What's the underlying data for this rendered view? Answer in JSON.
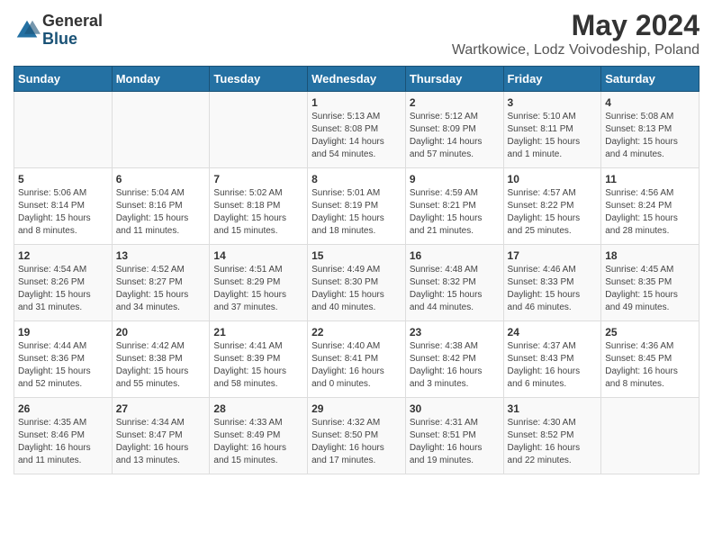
{
  "header": {
    "logo_general": "General",
    "logo_blue": "Blue",
    "month_title": "May 2024",
    "location": "Wartkowice, Lodz Voivodeship, Poland"
  },
  "weekdays": [
    "Sunday",
    "Monday",
    "Tuesday",
    "Wednesday",
    "Thursday",
    "Friday",
    "Saturday"
  ],
  "weeks": [
    [
      {
        "day": "",
        "info": ""
      },
      {
        "day": "",
        "info": ""
      },
      {
        "day": "",
        "info": ""
      },
      {
        "day": "1",
        "info": "Sunrise: 5:13 AM\nSunset: 8:08 PM\nDaylight: 14 hours\nand 54 minutes."
      },
      {
        "day": "2",
        "info": "Sunrise: 5:12 AM\nSunset: 8:09 PM\nDaylight: 14 hours\nand 57 minutes."
      },
      {
        "day": "3",
        "info": "Sunrise: 5:10 AM\nSunset: 8:11 PM\nDaylight: 15 hours\nand 1 minute."
      },
      {
        "day": "4",
        "info": "Sunrise: 5:08 AM\nSunset: 8:13 PM\nDaylight: 15 hours\nand 4 minutes."
      }
    ],
    [
      {
        "day": "5",
        "info": "Sunrise: 5:06 AM\nSunset: 8:14 PM\nDaylight: 15 hours\nand 8 minutes."
      },
      {
        "day": "6",
        "info": "Sunrise: 5:04 AM\nSunset: 8:16 PM\nDaylight: 15 hours\nand 11 minutes."
      },
      {
        "day": "7",
        "info": "Sunrise: 5:02 AM\nSunset: 8:18 PM\nDaylight: 15 hours\nand 15 minutes."
      },
      {
        "day": "8",
        "info": "Sunrise: 5:01 AM\nSunset: 8:19 PM\nDaylight: 15 hours\nand 18 minutes."
      },
      {
        "day": "9",
        "info": "Sunrise: 4:59 AM\nSunset: 8:21 PM\nDaylight: 15 hours\nand 21 minutes."
      },
      {
        "day": "10",
        "info": "Sunrise: 4:57 AM\nSunset: 8:22 PM\nDaylight: 15 hours\nand 25 minutes."
      },
      {
        "day": "11",
        "info": "Sunrise: 4:56 AM\nSunset: 8:24 PM\nDaylight: 15 hours\nand 28 minutes."
      }
    ],
    [
      {
        "day": "12",
        "info": "Sunrise: 4:54 AM\nSunset: 8:26 PM\nDaylight: 15 hours\nand 31 minutes."
      },
      {
        "day": "13",
        "info": "Sunrise: 4:52 AM\nSunset: 8:27 PM\nDaylight: 15 hours\nand 34 minutes."
      },
      {
        "day": "14",
        "info": "Sunrise: 4:51 AM\nSunset: 8:29 PM\nDaylight: 15 hours\nand 37 minutes."
      },
      {
        "day": "15",
        "info": "Sunrise: 4:49 AM\nSunset: 8:30 PM\nDaylight: 15 hours\nand 40 minutes."
      },
      {
        "day": "16",
        "info": "Sunrise: 4:48 AM\nSunset: 8:32 PM\nDaylight: 15 hours\nand 44 minutes."
      },
      {
        "day": "17",
        "info": "Sunrise: 4:46 AM\nSunset: 8:33 PM\nDaylight: 15 hours\nand 46 minutes."
      },
      {
        "day": "18",
        "info": "Sunrise: 4:45 AM\nSunset: 8:35 PM\nDaylight: 15 hours\nand 49 minutes."
      }
    ],
    [
      {
        "day": "19",
        "info": "Sunrise: 4:44 AM\nSunset: 8:36 PM\nDaylight: 15 hours\nand 52 minutes."
      },
      {
        "day": "20",
        "info": "Sunrise: 4:42 AM\nSunset: 8:38 PM\nDaylight: 15 hours\nand 55 minutes."
      },
      {
        "day": "21",
        "info": "Sunrise: 4:41 AM\nSunset: 8:39 PM\nDaylight: 15 hours\nand 58 minutes."
      },
      {
        "day": "22",
        "info": "Sunrise: 4:40 AM\nSunset: 8:41 PM\nDaylight: 16 hours\nand 0 minutes."
      },
      {
        "day": "23",
        "info": "Sunrise: 4:38 AM\nSunset: 8:42 PM\nDaylight: 16 hours\nand 3 minutes."
      },
      {
        "day": "24",
        "info": "Sunrise: 4:37 AM\nSunset: 8:43 PM\nDaylight: 16 hours\nand 6 minutes."
      },
      {
        "day": "25",
        "info": "Sunrise: 4:36 AM\nSunset: 8:45 PM\nDaylight: 16 hours\nand 8 minutes."
      }
    ],
    [
      {
        "day": "26",
        "info": "Sunrise: 4:35 AM\nSunset: 8:46 PM\nDaylight: 16 hours\nand 11 minutes."
      },
      {
        "day": "27",
        "info": "Sunrise: 4:34 AM\nSunset: 8:47 PM\nDaylight: 16 hours\nand 13 minutes."
      },
      {
        "day": "28",
        "info": "Sunrise: 4:33 AM\nSunset: 8:49 PM\nDaylight: 16 hours\nand 15 minutes."
      },
      {
        "day": "29",
        "info": "Sunrise: 4:32 AM\nSunset: 8:50 PM\nDaylight: 16 hours\nand 17 minutes."
      },
      {
        "day": "30",
        "info": "Sunrise: 4:31 AM\nSunset: 8:51 PM\nDaylight: 16 hours\nand 19 minutes."
      },
      {
        "day": "31",
        "info": "Sunrise: 4:30 AM\nSunset: 8:52 PM\nDaylight: 16 hours\nand 22 minutes."
      },
      {
        "day": "",
        "info": ""
      }
    ]
  ]
}
